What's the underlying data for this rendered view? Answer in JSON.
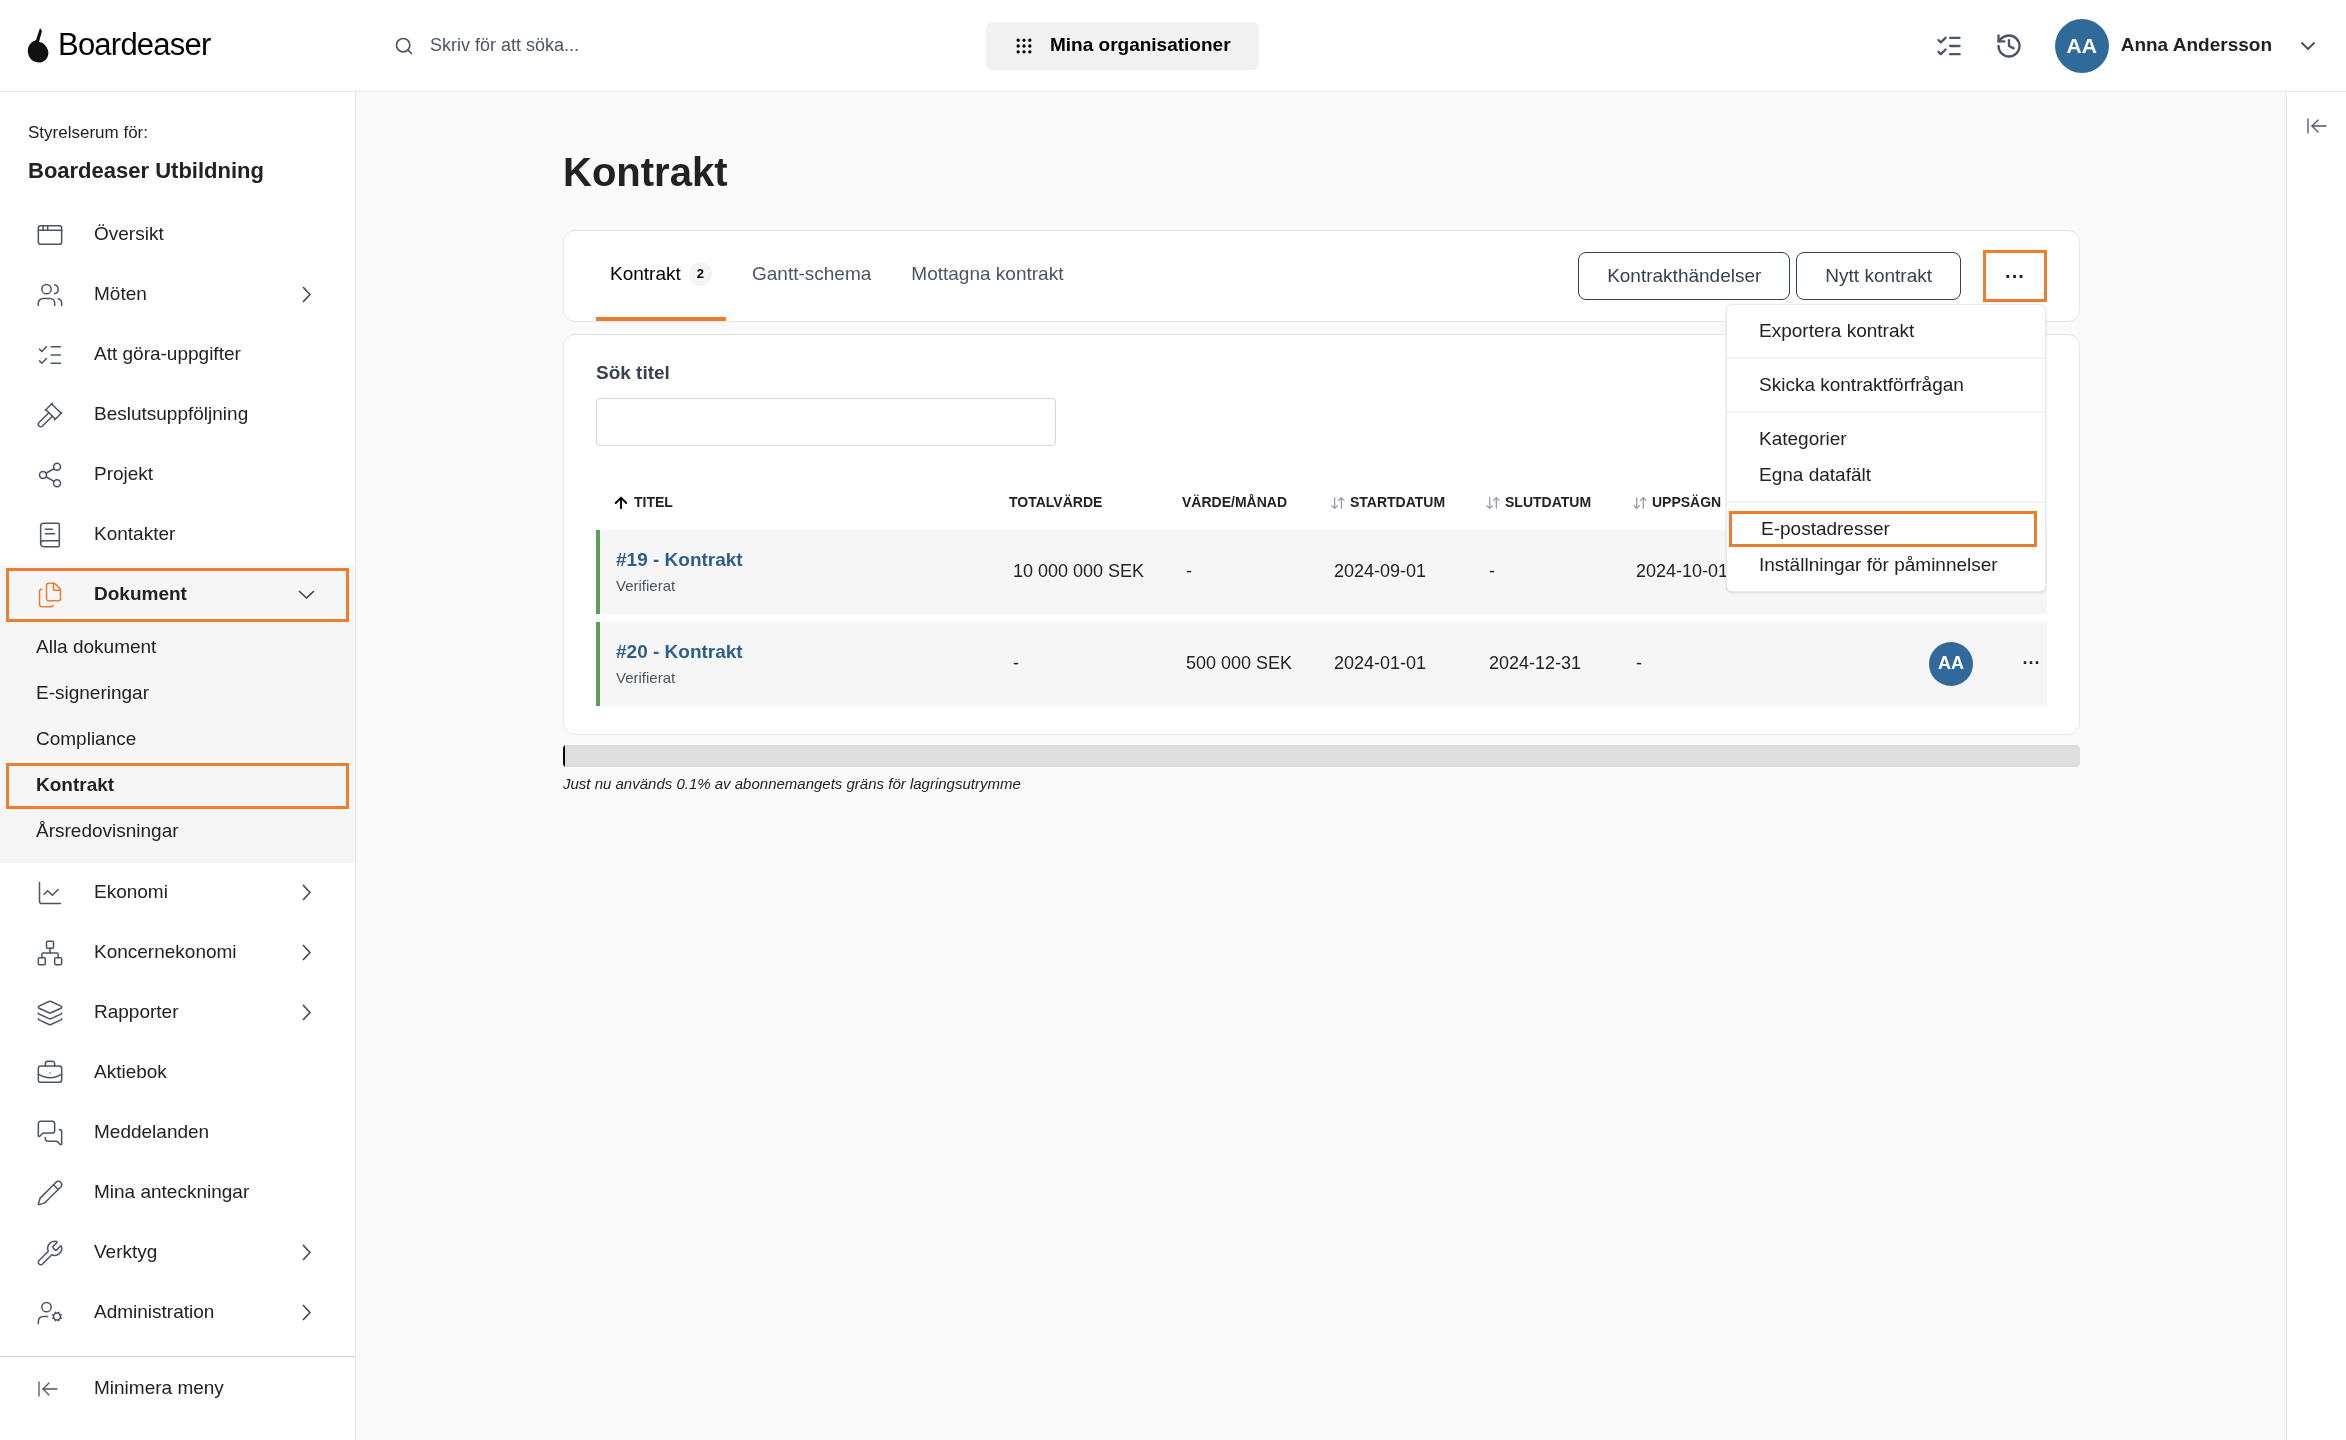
{
  "header": {
    "brand": "Boardeaser",
    "search": {
      "placeholder": "Skriv för att söka..."
    },
    "org_button": "Mina organisationer",
    "user": {
      "initials": "AA",
      "name": "Anna Andersson"
    }
  },
  "sidebar": {
    "caption": "Styrelserum för:",
    "org": "Boardeaser Utbildning",
    "items": [
      {
        "label": "Översikt",
        "has_submenu": false,
        "expanded": false,
        "highlighted": false
      },
      {
        "label": "Möten",
        "has_submenu": true,
        "expanded": false,
        "highlighted": false
      },
      {
        "label": "Att göra-uppgifter",
        "has_submenu": false,
        "expanded": false,
        "highlighted": false
      },
      {
        "label": "Beslutsuppföljning",
        "has_submenu": false,
        "expanded": false,
        "highlighted": false
      },
      {
        "label": "Projekt",
        "has_submenu": false,
        "expanded": false,
        "highlighted": false
      },
      {
        "label": "Kontakter",
        "has_submenu": false,
        "expanded": false,
        "highlighted": false
      },
      {
        "label": "Dokument",
        "has_submenu": true,
        "expanded": true,
        "highlighted": true,
        "children": [
          {
            "label": "Alla dokument",
            "selected": false,
            "highlighted": false
          },
          {
            "label": "E-signeringar",
            "selected": false,
            "highlighted": false
          },
          {
            "label": "Compliance",
            "selected": false,
            "highlighted": false
          },
          {
            "label": "Kontrakt",
            "selected": true,
            "highlighted": true
          },
          {
            "label": "Årsredovisningar",
            "selected": false,
            "highlighted": false
          }
        ]
      },
      {
        "label": "Ekonomi",
        "has_submenu": true,
        "expanded": false,
        "highlighted": false
      },
      {
        "label": "Koncernekonomi",
        "has_submenu": true,
        "expanded": false,
        "highlighted": false
      },
      {
        "label": "Rapporter",
        "has_submenu": true,
        "expanded": false,
        "highlighted": false
      },
      {
        "label": "Aktiebok",
        "has_submenu": false,
        "expanded": false,
        "highlighted": false
      },
      {
        "label": "Meddelanden",
        "has_submenu": false,
        "expanded": false,
        "highlighted": false
      },
      {
        "label": "Mina anteckningar",
        "has_submenu": false,
        "expanded": false,
        "highlighted": false
      },
      {
        "label": "Verktyg",
        "has_submenu": true,
        "expanded": false,
        "highlighted": false
      },
      {
        "label": "Administration",
        "has_submenu": true,
        "expanded": false,
        "highlighted": false
      }
    ],
    "collapse": "Minimera meny"
  },
  "page": {
    "title": "Kontrakt",
    "tabs": [
      {
        "label": "Kontrakt",
        "count": "2",
        "selected": true
      },
      {
        "label": "Gantt-schema",
        "selected": false
      },
      {
        "label": "Mottagna kontrakt",
        "selected": false
      }
    ],
    "buttons": [
      "Kontrakthändelser",
      "Nytt kontrakt"
    ],
    "more_button": {
      "label": "···",
      "highlighted": true
    },
    "menu": [
      [
        {
          "label": "Exportera kontrakt",
          "highlighted": false
        }
      ],
      [
        {
          "label": "Skicka kontraktförfrågan",
          "highlighted": false
        }
      ],
      [
        {
          "label": "Kategorier",
          "highlighted": false
        },
        {
          "label": "Egna datafält",
          "highlighted": false
        }
      ],
      [
        {
          "label": "E-postadresser",
          "highlighted": true
        },
        {
          "label": "Inställningar för påminnelser",
          "highlighted": false
        }
      ]
    ],
    "search_label": "Sök titel",
    "table": {
      "columns": [
        {
          "label": "TITEL",
          "sortable": true,
          "sorted": true
        },
        {
          "label": "TOTALVÄRDE",
          "sortable": false
        },
        {
          "label": "VÄRDE/MÅNAD",
          "sortable": false
        },
        {
          "label": "STARTDATUM",
          "sortable": true,
          "sorted": false
        },
        {
          "label": "SLUTDATUM",
          "sortable": true,
          "sorted": false
        },
        {
          "label": "UPPSÄGN",
          "sortable": true,
          "sorted": false
        }
      ],
      "rows": [
        {
          "cells": [
            "#19 - Kontrakt",
            "10 000 000 SEK",
            "-",
            "2024-09-01",
            "-",
            "2024-10-01"
          ],
          "status": "Verifierat",
          "color": "#5a9e5a"
        },
        {
          "cells": [
            "#20 - Kontrakt",
            "-",
            "500 000 SEK",
            "2024-01-01",
            "2024-12-31",
            "-"
          ],
          "status": "Verifierat",
          "color": "#5a9e5a",
          "avatar": "AA",
          "actions": "···"
        }
      ]
    },
    "storage": {
      "level": 0.001,
      "note": "Just nu används 0.1% av abonnemangets gräns för lagringsutrymme"
    }
  }
}
